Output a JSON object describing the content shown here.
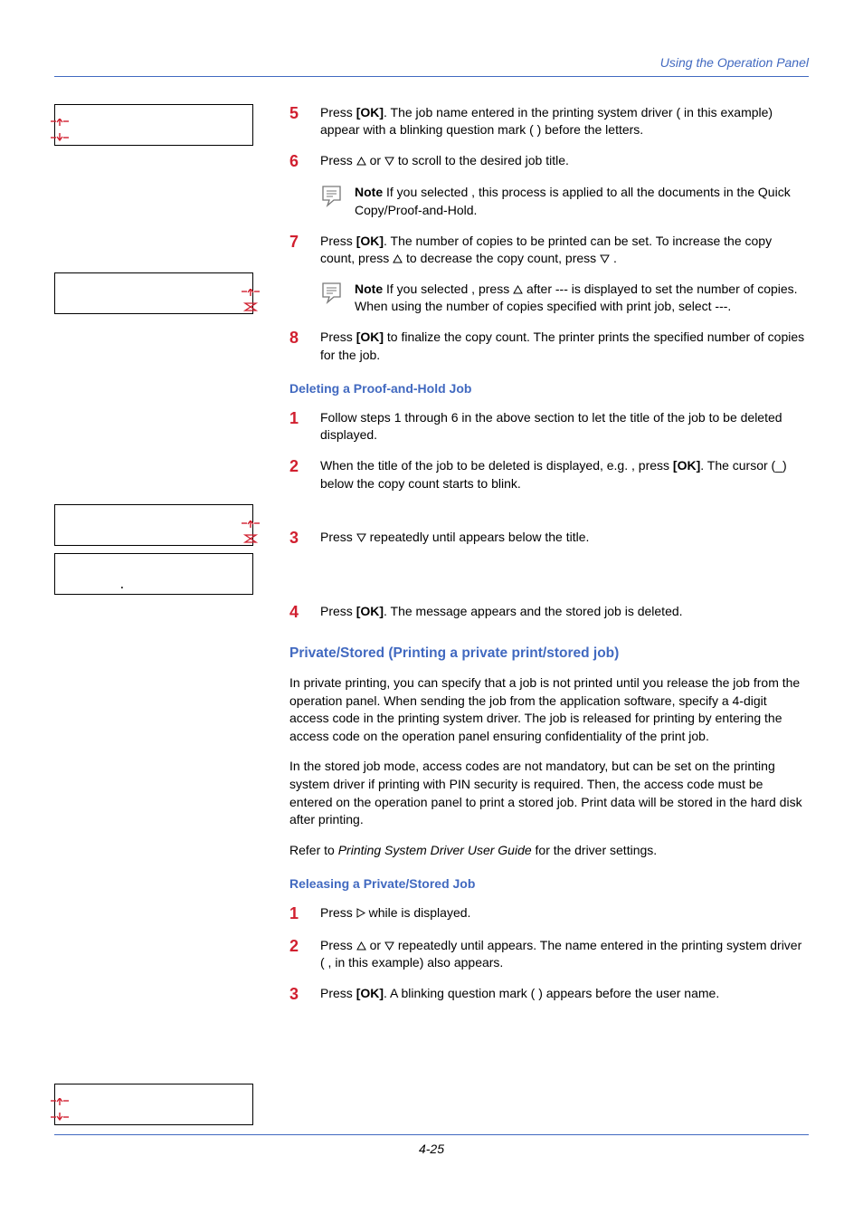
{
  "header": {
    "section_title": "Using the Operation Panel"
  },
  "steps_top": {
    "s5": {
      "pre": "Press ",
      "ok": "[OK]",
      "post": ". The job name entered in the printing system driver (            in this example) appear with a blinking question mark ( ) before the letters."
    },
    "s6": {
      "pre": "Press ",
      "mid": " or ",
      "post": " to scroll to the desired job title."
    },
    "note6": {
      "label": "Note",
      "text": "  If you selected                 , this process is applied to all the documents in the Quick Copy/Proof-and-Hold."
    },
    "s7": {
      "pre": "Press ",
      "ok": "[OK]",
      "mid": ". The number of copies to be printed can be set. To increase the copy count, press ",
      "mid2": " to decrease the copy count, press ",
      "end": "."
    },
    "note7": {
      "label": "Note",
      "text1": "  If you selected                  , press ",
      "text2": " after            --- is displayed to set the number of copies. When using the number of copies specified with print job, select           ---."
    },
    "s8": {
      "pre": "Press ",
      "ok": "[OK]",
      "post": " to finalize the copy count. The printer prints the specified number of copies for the job."
    }
  },
  "del_heading": "Deleting a Proof-and-Hold Job",
  "del_steps": {
    "d1": "Follow steps 1 through 6 in the above section to let the title of the job to be deleted displayed.",
    "d2": {
      "pre": "When the title of the job to be deleted is displayed, e.g.              , press ",
      "ok": "[OK]",
      "post": ". The cursor (_) below the copy count starts to blink."
    },
    "d3": {
      "pre": "Press ",
      "mid": " repeatedly until               appears below the title."
    },
    "d4": {
      "pre": "Press ",
      "ok": "[OK]",
      "post": ". The message                      appears and the stored job is deleted."
    }
  },
  "priv_heading": "Private/Stored (Printing a private print/stored job)",
  "priv_p1": "In private printing, you can specify that a job is not printed until you release the job from the operation panel. When sending the job from the application software, specify a 4-digit access code in the printing system driver. The job is released for printing by entering the access code on the operation panel ensuring confidentiality of the print job.",
  "priv_p2": "In the stored job mode, access codes are not mandatory, but can be set on the printing system driver if printing with PIN security is required. Then, the access code must be entered on the operation panel to print a stored job. Print data will be stored in the hard disk after printing.",
  "priv_p3_pre": "Refer to ",
  "priv_p3_italic": "Printing System Driver User Guide",
  "priv_p3_post": " for the driver settings.",
  "rel_heading": "Releasing a Private/Stored Job",
  "rel_steps": {
    "r1": {
      "pre": "Press ",
      "mid": " while                  is displayed."
    },
    "r2": {
      "pre": "Press ",
      "or": " or ",
      "mid": " repeatedly until                              appears. The name entered in the printing system driver (            , in this example) also appears."
    },
    "r3": {
      "pre": "Press ",
      "ok": "[OK]",
      "post": ". A blinking question mark ( ) appears before the user name."
    }
  },
  "lcd_dot": ".",
  "footer": {
    "page_number": "4-25"
  }
}
